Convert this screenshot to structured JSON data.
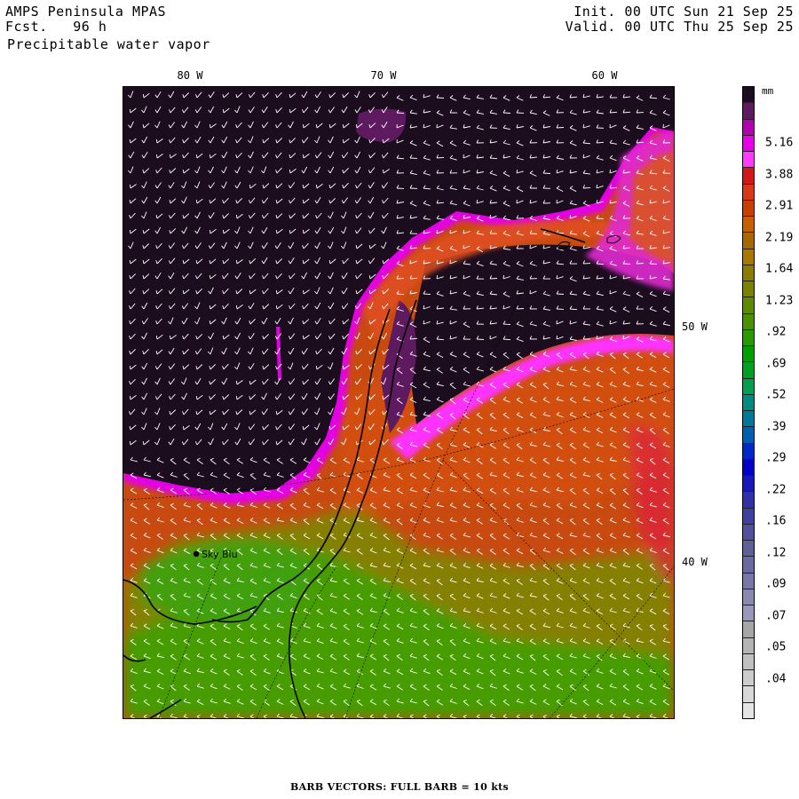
{
  "header": {
    "model": "AMPS Peninsula MPAS",
    "forecast": "Fcst.   96 h",
    "field": "Precipitable water vapor",
    "init": "Init. 00 UTC Sun 21 Sep 25",
    "valid": "Valid. 00 UTC Thu 25 Sep 25"
  },
  "axes": {
    "lon_labels": [
      "80 W",
      "70 W",
      "60 W"
    ],
    "lat_labels": [
      "50 W",
      "40 W"
    ]
  },
  "station": {
    "name": "Sky Blu"
  },
  "colorbar": {
    "unit": "mm",
    "labels": [
      "5.16",
      "3.88",
      "2.91",
      "2.19",
      "1.64",
      "1.23",
      ".92",
      ".69",
      ".52",
      ".39",
      ".29",
      ".22",
      ".16",
      ".12",
      ".09",
      ".07",
      ".05",
      ".04"
    ],
    "colors": [
      "#1b0d1e",
      "#5e1a5e",
      "#b000b0",
      "#e800e8",
      "#ff3aff",
      "#d01818",
      "#d83818",
      "#c84000",
      "#c86000",
      "#a86800",
      "#a87800",
      "#8a7c00",
      "#7a8200",
      "#5e8a00",
      "#4a9000",
      "#2a9a00",
      "#00a000",
      "#00a020",
      "#00a050",
      "#008a80",
      "#007898",
      "#0060b0",
      "#0028c8",
      "#0000c8",
      "#1818b8",
      "#3030a8",
      "#4040a0",
      "#50509c",
      "#606098",
      "#6a6aa0",
      "#7878a8",
      "#8a8ab0",
      "#9898b8",
      "#a6a6a6",
      "#b4b4b4",
      "#c0c0c0",
      "#cccccc",
      "#d8d8d8",
      "#e4e4e4"
    ]
  },
  "footer": "BARB VECTORS:  FULL BARB = 10 kts"
}
